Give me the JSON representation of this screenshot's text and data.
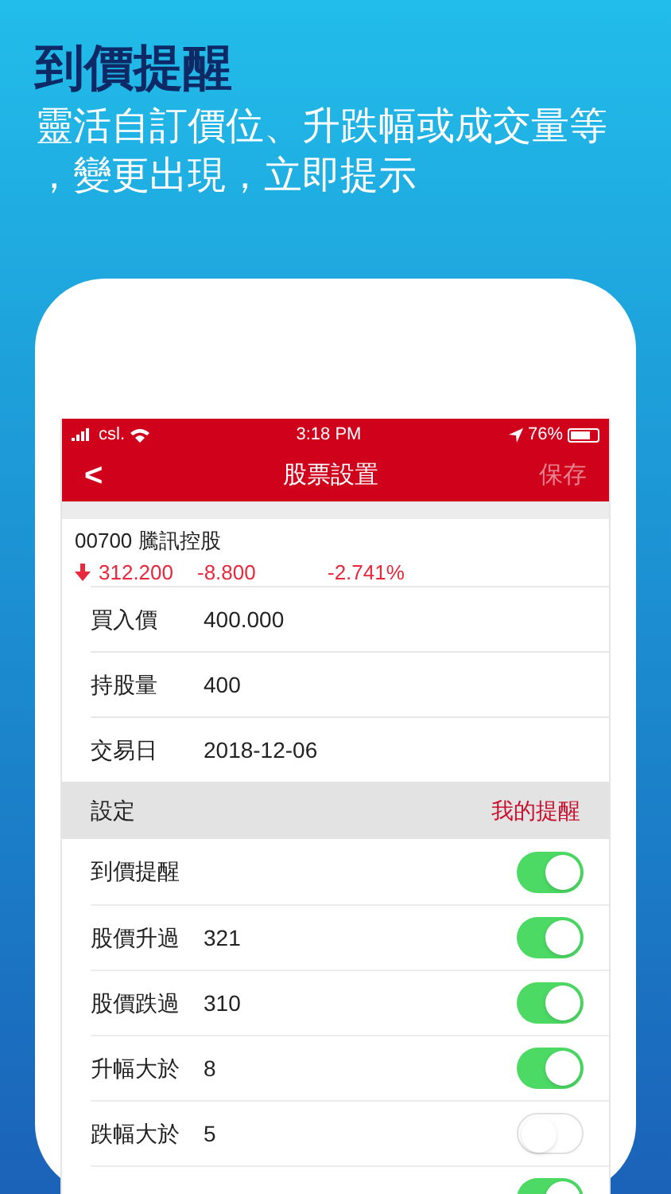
{
  "headline": "到價提醒",
  "subtitle_lines": [
    "靈活自訂價位、升跌幅或成交量等",
    "，變更出現，立即提示"
  ],
  "status_bar": {
    "carrier": "csl.",
    "time": "3:18 PM",
    "battery": "76%"
  },
  "nav": {
    "back": "<",
    "title": "股票設置",
    "action": "保存"
  },
  "stock": {
    "code_name": "00700 騰訊控股",
    "price": "312.200",
    "change": "-8.800",
    "change_pct": "-2.741%"
  },
  "fields": [
    {
      "label": "買入價",
      "value": "400.000"
    },
    {
      "label": "持股量",
      "value": "400"
    },
    {
      "label": "交易日",
      "value": "2018-12-06"
    }
  ],
  "section": {
    "title": "設定",
    "link": "我的提醒"
  },
  "alerts": [
    {
      "label": "到價提醒",
      "on": true
    },
    {
      "label": "股價升過",
      "value": "321",
      "on": true
    },
    {
      "label": "股價跌過",
      "value": "310",
      "on": true
    },
    {
      "label": "升幅大於",
      "value": "8",
      "on": true
    },
    {
      "label": "跌幅大於",
      "value": "5",
      "on": false
    },
    {
      "on": true
    }
  ]
}
